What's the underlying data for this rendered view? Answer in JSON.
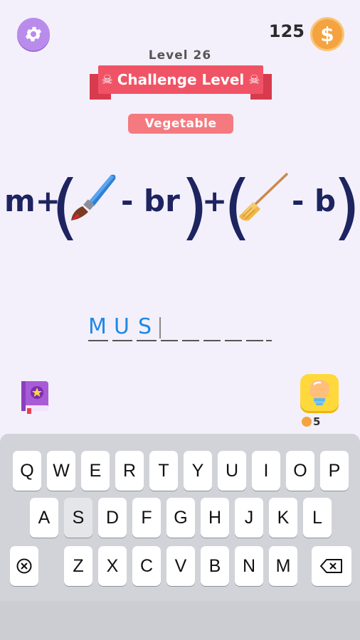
{
  "header": {
    "coins": "125",
    "coin_symbol": "$",
    "level_label": "Level 26",
    "challenge_label": "Challenge Level",
    "category": "Vegetable"
  },
  "puzzle": {
    "prefix": "m+",
    "term1_icon": "paintbrush-icon",
    "term1_minus": "- br",
    "plus": "+",
    "term2_icon": "broom-icon",
    "term2_minus": "- b"
  },
  "answer": {
    "letters": [
      "M",
      "U",
      "S"
    ],
    "total_slots": 9
  },
  "hint": {
    "count": "5"
  },
  "keyboard": {
    "row1": [
      "Q",
      "W",
      "E",
      "R",
      "T",
      "Y",
      "U",
      "I",
      "O",
      "P"
    ],
    "row2": [
      "A",
      "S",
      "D",
      "F",
      "G",
      "H",
      "J",
      "K",
      "L"
    ],
    "row3": [
      "Z",
      "X",
      "C",
      "V",
      "B",
      "N",
      "M"
    ],
    "pressed_key": "S",
    "left_func_icon": "clear-icon",
    "right_func_icon": "backspace-icon"
  }
}
